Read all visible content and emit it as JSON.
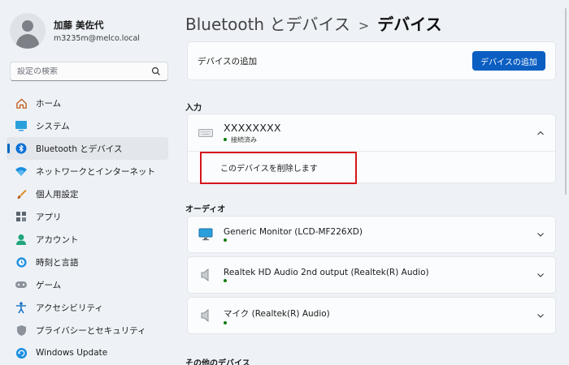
{
  "profile": {
    "name": "加藤 美佐代",
    "email": "m3235m@melco.local"
  },
  "search": {
    "placeholder": "設定の検索"
  },
  "nav": {
    "items": [
      {
        "label": "ホーム",
        "icon": "home-icon"
      },
      {
        "label": "システム",
        "icon": "system-icon"
      },
      {
        "label": "Bluetooth とデバイス",
        "icon": "bluetooth-icon",
        "active": true
      },
      {
        "label": "ネットワークとインターネット",
        "icon": "wifi-icon"
      },
      {
        "label": "個人用設定",
        "icon": "brush-icon"
      },
      {
        "label": "アプリ",
        "icon": "apps-icon"
      },
      {
        "label": "アカウント",
        "icon": "account-icon"
      },
      {
        "label": "時刻と言語",
        "icon": "time-language-icon"
      },
      {
        "label": "ゲーム",
        "icon": "gamepad-icon"
      },
      {
        "label": "アクセシビリティ",
        "icon": "accessibility-icon"
      },
      {
        "label": "プライバシーとセキュリティ",
        "icon": "shield-icon"
      },
      {
        "label": "Windows Update",
        "icon": "update-icon"
      }
    ]
  },
  "breadcrumb": {
    "parent": "Bluetooth とデバイス",
    "separator": ">",
    "current": "デバイス"
  },
  "add_device": {
    "label": "デバイスの追加",
    "button": "デバイスの追加"
  },
  "sections": {
    "input": "入力",
    "audio": "オーディオ",
    "other": "その他のデバイス"
  },
  "keyboard_device": {
    "name": "XXXXXXXX",
    "status": "接続済み",
    "remove_label": "このデバイスを削除します"
  },
  "audio_devices": [
    {
      "name": "Generic Monitor (LCD-MF226XD)",
      "icon": "monitor-icon"
    },
    {
      "name": "Realtek HD Audio 2nd output (Realtek(R) Audio)",
      "icon": "speaker-icon"
    },
    {
      "name": "マイク (Realtek(R) Audio)",
      "icon": "speaker-icon"
    }
  ],
  "colors": {
    "accent": "#0067c0",
    "highlight_box": "#d5161b",
    "connected_dot": "#107c10"
  }
}
